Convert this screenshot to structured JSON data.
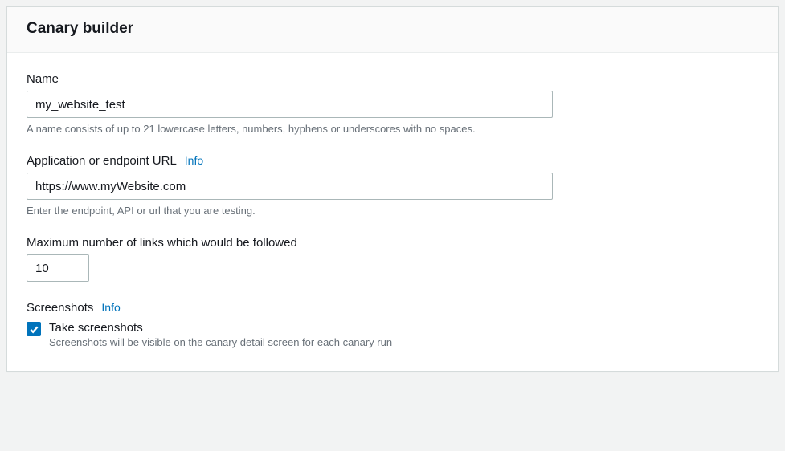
{
  "panel": {
    "title": "Canary builder"
  },
  "fields": {
    "name": {
      "label": "Name",
      "value": "my_website_test",
      "hint": "A name consists of up to 21 lowercase letters, numbers, hyphens or underscores with no spaces."
    },
    "endpoint": {
      "label": "Application or endpoint URL",
      "info": "Info",
      "value": "https://www.myWebsite.com",
      "hint": "Enter the endpoint, API or url that you are testing."
    },
    "maxLinks": {
      "label": "Maximum number of links which would be followed",
      "value": "10"
    },
    "screenshots": {
      "label": "Screenshots",
      "info": "Info",
      "checkboxLabel": "Take screenshots",
      "checkboxDesc": "Screenshots will be visible on the canary detail screen for each canary run"
    }
  }
}
